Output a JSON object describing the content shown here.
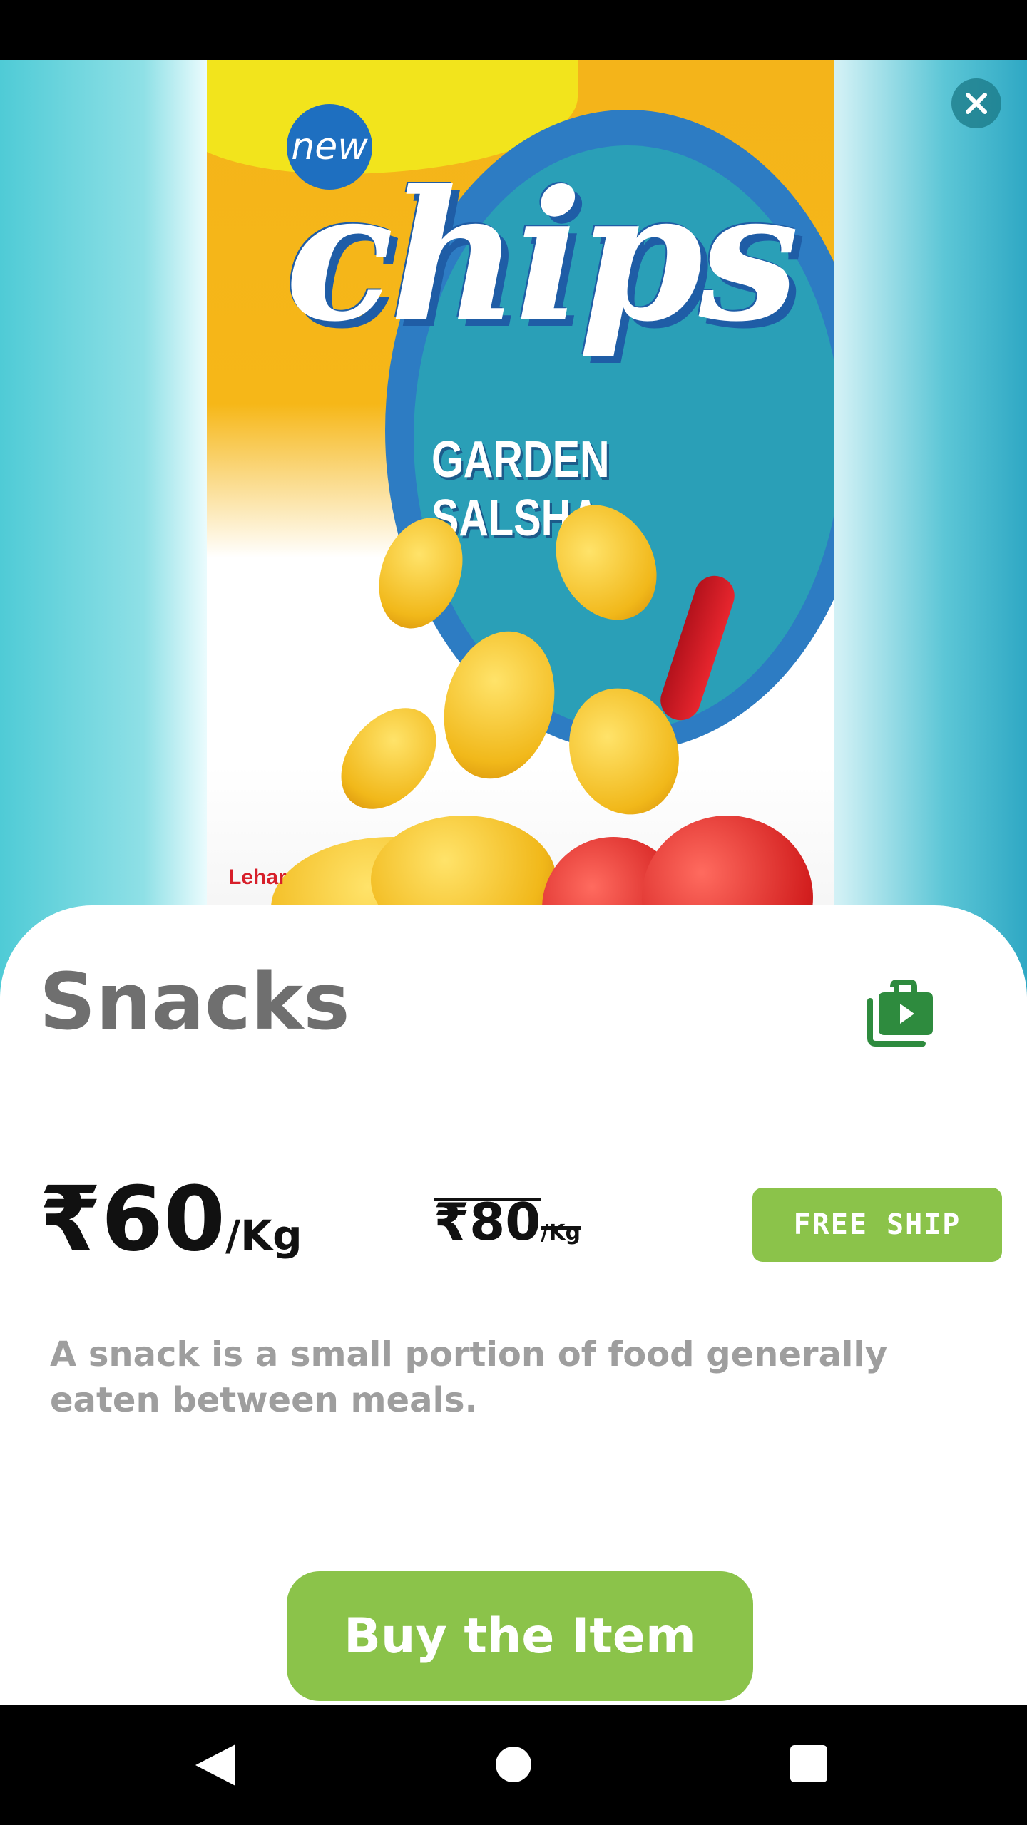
{
  "hero": {
    "badge": "new",
    "brand_word": "chips",
    "flavor": "GARDEN SALSHA",
    "maker": "Lehar"
  },
  "product": {
    "title": "Snacks",
    "price": "₹60",
    "price_unit": "/Kg",
    "old_price": "₹80",
    "old_price_unit": "/Kg",
    "shipping_badge": "FREE SHIP",
    "description": "A snack is a small portion of food generally eaten between meals.",
    "buy_label": "Buy the Item"
  },
  "colors": {
    "accent_green": "#8bc34a",
    "title_gray": "#6f6f6f",
    "description_gray": "#9e9e9e",
    "close_teal": "#1a7886"
  },
  "icons": {
    "close": "close-icon",
    "share": "shopping-bag-play-icon",
    "nav_back": "back-triangle-icon",
    "nav_home": "home-circle-icon",
    "nav_recents": "recents-square-icon"
  }
}
